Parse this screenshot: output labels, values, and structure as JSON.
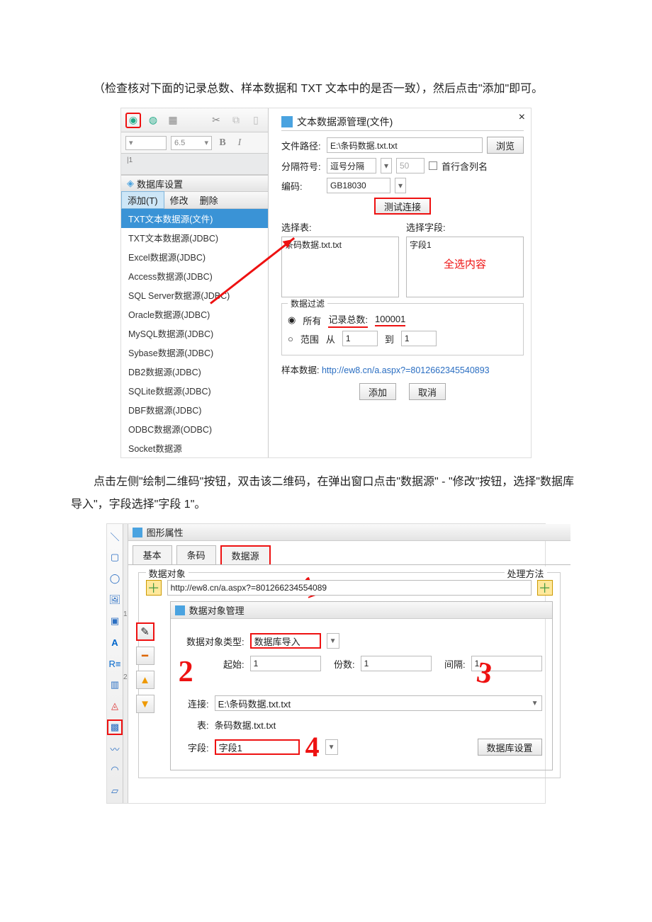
{
  "paragraph1": "（检查核对下面的记录总数、样本数据和 TXT 文本中的是否一致），然后点击\"添加\"即可。",
  "paragraph2": "点击左侧\"绘制二维码\"按钮，双击该二维码，在弹出窗口点击\"数据源\" - \"修改\"按钮，选择\"数据库导入\"，字段选择\"字段 1\"。",
  "fig1": {
    "leftPanel": {
      "fontSize": "6.5",
      "bold": "B",
      "italic": "I",
      "rulerMark": "|1",
      "panelTitle": "数据库设置",
      "menu": {
        "add": "添加(T)",
        "modify": "修改",
        "delete": "删除"
      },
      "sources": [
        "TXT文本数据源(文件)",
        "TXT文本数据源(JDBC)",
        "Excel数据源(JDBC)",
        "Access数据源(JDBC)",
        "SQL Server数据源(JDBC)",
        "Oracle数据源(JDBC)",
        "MySQL数据源(JDBC)",
        "Sybase数据源(JDBC)",
        "DB2数据源(JDBC)",
        "SQLite数据源(JDBC)",
        "DBF数据源(JDBC)",
        "ODBC数据源(ODBC)",
        "Socket数据源"
      ]
    },
    "dialog": {
      "title": "文本数据源管理(文件)",
      "filePathLabel": "文件路径:",
      "filePath": "E:\\条码数据.txt.txt",
      "browse": "浏览",
      "sepLabel": "分隔符号:",
      "sepValue": "逗号分隔",
      "sepCount": "50",
      "firstRowLabel": "首行含列名",
      "encodingLabel": "编码:",
      "encoding": "GB18030",
      "testBtn": "测试连接",
      "selectTable": "选择表:",
      "selectField": "选择字段:",
      "tableItem": "条码数据.txt.txt",
      "fieldItem": "字段1",
      "selectAll": "全选内容",
      "filterLegend": "数据过滤",
      "radioAll": "所有",
      "radioRange": "范围",
      "recTotalLabel": "记录总数:",
      "recTotal": "100001",
      "from": "从",
      "to": "到",
      "one": "1",
      "sampleLabel": "样本数据:",
      "sampleUrl": "http://ew8.cn/a.aspx?=8012662345540893",
      "addBtn": "添加",
      "cancelBtn": "取消"
    }
  },
  "fig2": {
    "header": "图形属性",
    "tabs": {
      "basic": "基本",
      "barcode": "条码",
      "source": "数据源"
    },
    "fieldset": {
      "legend": "数据对象",
      "right": "处理方法"
    },
    "url": "http://ew8.cn/a.aspx?=801266234554089",
    "innerDlg": {
      "title": "数据对象管理",
      "typeLabel": "数据对象类型:",
      "typeValue": "数据库导入",
      "startLabel": "起始:",
      "start": "1",
      "countLabel": "份数:",
      "count": "1",
      "gapLabel": "间隔:",
      "gap": "1",
      "connLabel": "连接:",
      "connValue": "E:\\条码数据.txt.txt",
      "tableLabel": "表:",
      "tableValue": "条码数据.txt.txt",
      "fieldLabel": "字段:",
      "fieldValue": "字段1",
      "dbSettingBtn": "数据库设置"
    }
  }
}
